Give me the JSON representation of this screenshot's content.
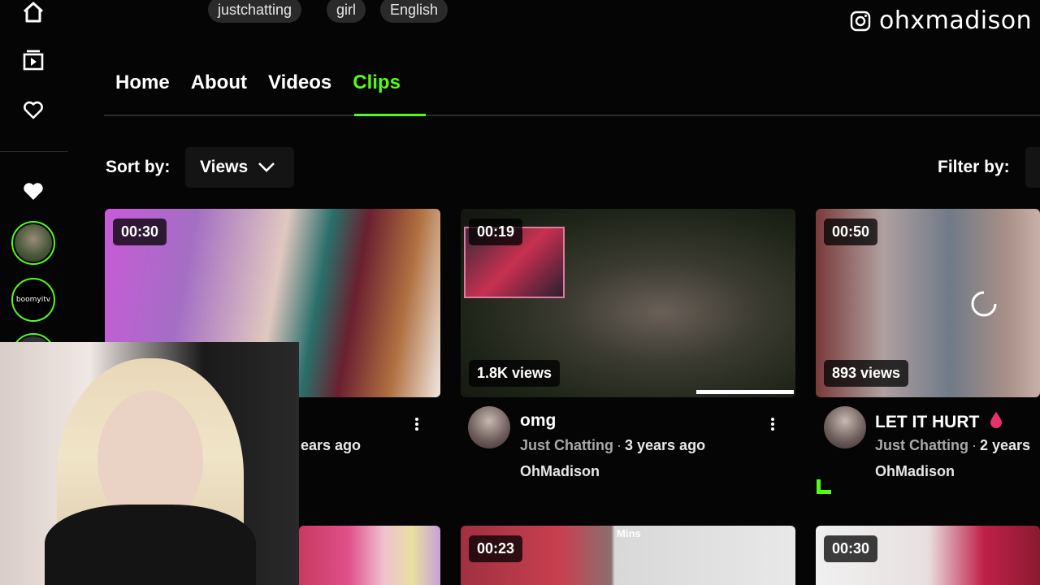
{
  "tags": [
    "justchatting",
    "girl",
    "English"
  ],
  "instagram": {
    "icon": "instagram-icon",
    "handle": "ohxmadison"
  },
  "rail": {
    "icons": [
      "home-icon",
      "videos-icon",
      "heart-outline-icon",
      "heart-filled-icon"
    ],
    "followed_channel_label": "boomyitv"
  },
  "tabs": [
    {
      "label": "Home",
      "active": false
    },
    {
      "label": "About",
      "active": false
    },
    {
      "label": "Videos",
      "active": false
    },
    {
      "label": "Clips",
      "active": true
    }
  ],
  "sort": {
    "label": "Sort by:",
    "value": "Views",
    "icon": "chevron-down-icon"
  },
  "filter": {
    "label": "Filter by:"
  },
  "clips": [
    {
      "duration": "00:30",
      "views": "",
      "title": "",
      "category": "",
      "age": "ears ago",
      "user": ""
    },
    {
      "duration": "00:19",
      "views": "1.8K views",
      "title": "omg",
      "category": "Just Chatting",
      "age": "3 years ago",
      "user": "OhMadison"
    },
    {
      "duration": "00:50",
      "views": "893 views",
      "title": "LET IT HURT",
      "category": "Just Chatting",
      "age": "2 years",
      "user": "OhMadison"
    },
    {
      "duration": "",
      "views": "",
      "title": "",
      "category": "",
      "age": "",
      "user": ""
    },
    {
      "duration": "00:23",
      "views": "",
      "title": "",
      "category": "",
      "age": "",
      "user": "",
      "overlay_text": "Mins"
    },
    {
      "duration": "00:30",
      "views": "",
      "title": "",
      "category": "",
      "age": "",
      "user": ""
    }
  ],
  "colors": {
    "accent": "#53fc18",
    "background": "#050505",
    "surface": "#141414",
    "tag": "#2a2a2a"
  }
}
